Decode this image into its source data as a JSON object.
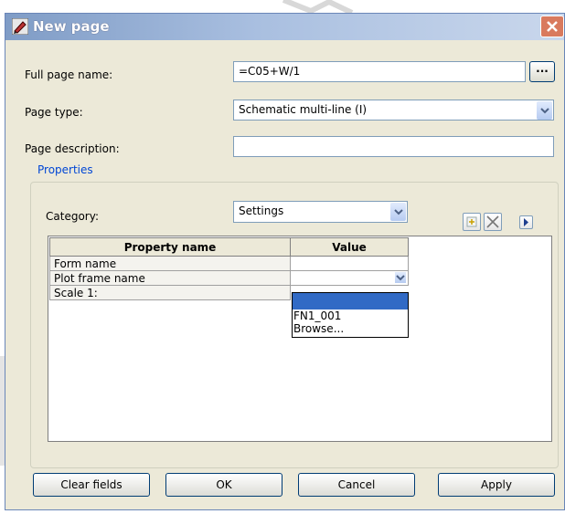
{
  "window": {
    "title": "New page",
    "app_icon": "eplan-pencil-icon",
    "close_icon": "close-x-icon"
  },
  "form": {
    "full_page_name": {
      "label": "Full page name:",
      "value": "=C05+W/1",
      "browse_label": "..."
    },
    "page_type": {
      "label": "Page type:",
      "value": "Schematic multi-line (I)"
    },
    "page_description": {
      "label": "Page description:",
      "value": ""
    }
  },
  "properties": {
    "legend": "Properties",
    "category": {
      "label": "Category:",
      "value": "Settings"
    },
    "toolbar_icons": [
      "new-property-icon",
      "delete-property-icon",
      "scroll-right-icon"
    ],
    "columns": [
      "Property name",
      "Value"
    ],
    "rows": [
      {
        "name": "Form name",
        "value": ""
      },
      {
        "name": "Plot frame name",
        "value": ""
      },
      {
        "name": "Scale 1:",
        "value": ""
      }
    ],
    "dropdown_options": [
      "",
      "FN1_001",
      "Browse..."
    ]
  },
  "buttons": {
    "clear": "Clear fields",
    "ok": "OK",
    "cancel": "Cancel",
    "apply": "Apply"
  },
  "colors": {
    "title_gradient_start": "#7f9cc6",
    "dialog_bg": "#ece9d8",
    "group_legend": "#0046d5",
    "selection": "#316ac5"
  }
}
